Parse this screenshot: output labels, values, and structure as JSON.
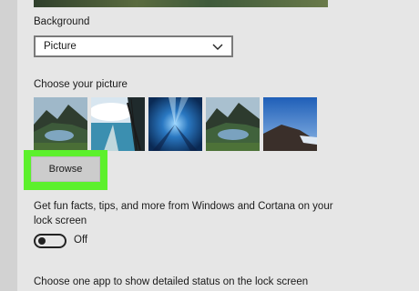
{
  "background": {
    "label": "Background",
    "selected": "Picture"
  },
  "picture": {
    "label": "Choose your picture",
    "thumbnails": [
      {
        "name": "mountain-lake"
      },
      {
        "name": "beach-cliff"
      },
      {
        "name": "underwater-light"
      },
      {
        "name": "mountain-lake-2"
      },
      {
        "name": "blue-sky-hill"
      }
    ],
    "browse_label": "Browse",
    "highlight_color": "#5cf02c"
  },
  "fun_facts": {
    "text": "Get fun facts, tips, and more from Windows and Cortana on your lock screen",
    "toggle_state": "Off"
  },
  "status_app": {
    "label": "Choose one app to show detailed status on the lock screen"
  },
  "icons": {
    "dropdown": "chevron-down-icon"
  }
}
